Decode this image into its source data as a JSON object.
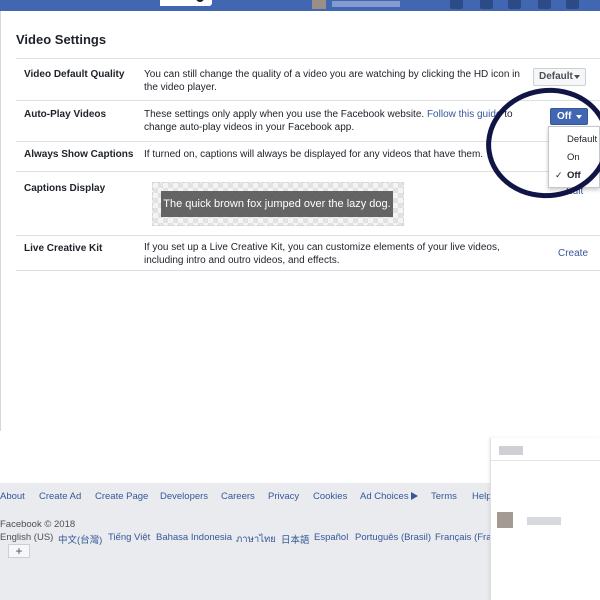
{
  "page_title": "Video Settings",
  "colors": {
    "brand_blue": "#4267b2",
    "link_blue": "#365899",
    "annotation_circle": "#101545"
  },
  "settings": {
    "video_quality": {
      "label": "Video Default Quality",
      "description": "You can still change the quality of a video you are watching by clicking the HD icon in the video player.",
      "value": "Default"
    },
    "autoplay": {
      "label": "Auto-Play Videos",
      "description_before": "These settings only apply when you use the Facebook website. ",
      "link_text": "Follow this guide",
      "description_after": " to change auto-play videos in your Facebook app.",
      "value": "Off",
      "options": [
        "Default",
        "On",
        "Off"
      ],
      "selected": "Off"
    },
    "captions": {
      "label": "Always Show Captions",
      "description": "If turned on, captions will always be displayed for any videos that have them."
    },
    "captions_display": {
      "label": "Captions Display",
      "preview_text": "The quick brown fox jumped over the lazy dog.",
      "edit_label": "Edit"
    },
    "live_kit": {
      "label": "Live Creative Kit",
      "description": "If you set up a Live Creative Kit, you can customize elements of your live videos, including intro and outro videos, and effects.",
      "action": "Create"
    }
  },
  "footer": {
    "links": [
      "About",
      "Create Ad",
      "Create Page",
      "Developers",
      "Careers",
      "Privacy",
      "Cookies",
      "Ad Choices",
      "Terms",
      "Help"
    ],
    "copyright": "Facebook © 2018",
    "languages": [
      "English (US)",
      "中文(台灣)",
      "Tiếng Việt",
      "Bahasa Indonesia",
      "ภาษาไทย",
      "日本語",
      "Español",
      "Português (Brasil)",
      "Français (France)"
    ],
    "add_language": "+"
  },
  "icons": {
    "search": "search-icon",
    "ad_choices": "ad-choices-icon",
    "dropdown": "chevron-down-icon",
    "check": "check-icon"
  }
}
